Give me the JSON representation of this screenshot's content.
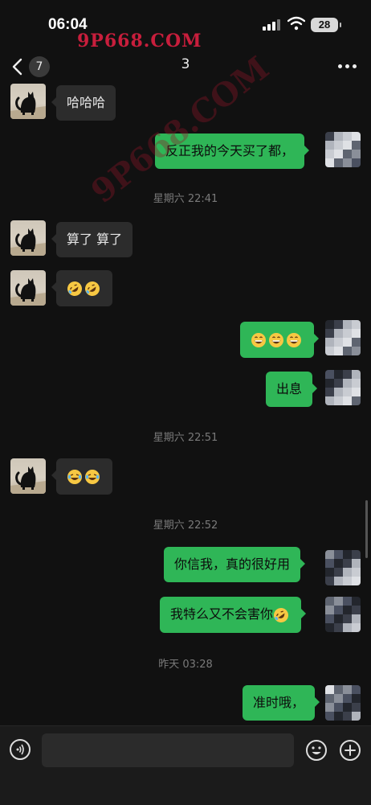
{
  "status_bar": {
    "time": "06:04",
    "battery": "28"
  },
  "watermark": {
    "top": "9P668.COM",
    "diagonal": "9P668.COM"
  },
  "nav": {
    "unread_count": "7",
    "title": "3"
  },
  "messages": [
    {
      "side": "in",
      "text": "哈哈哈"
    },
    {
      "side": "out",
      "text": "反正我的今天买了都，"
    },
    {
      "type": "time",
      "text": "星期六 22:41"
    },
    {
      "side": "in",
      "text": "算了  算了"
    },
    {
      "side": "in",
      "emoji": [
        "rofl-emoji",
        "rofl-emoji"
      ]
    },
    {
      "side": "out",
      "emoji": [
        "grin-emoji",
        "grin-emoji",
        "grin-emoji"
      ]
    },
    {
      "side": "out",
      "text": "出息"
    },
    {
      "type": "time",
      "text": "星期六 22:51"
    },
    {
      "side": "in",
      "emoji": [
        "laugh-tears-emoji",
        "laugh-tears-emoji"
      ]
    },
    {
      "type": "time",
      "text": "星期六 22:52"
    },
    {
      "side": "out",
      "text": "你信我，真的很好用"
    },
    {
      "side": "out",
      "text": "我特么又不会害你",
      "emoji": [
        "rofl-emoji"
      ]
    },
    {
      "type": "time",
      "text": "昨天 03:28"
    },
    {
      "side": "out",
      "text": "准时哦，"
    }
  ],
  "input": {
    "value": ""
  },
  "icons": [
    "signal-icon",
    "wifi-icon",
    "back-chevron-icon",
    "more-icon",
    "voice-icon",
    "emoji-icon",
    "plus-icon"
  ],
  "colors": {
    "background": "#111111",
    "incoming_bubble": "#2c2c2c",
    "outgoing_bubble": "#2fb657",
    "timestamp": "#7a7a7a",
    "watermark": "#c81e3c"
  }
}
